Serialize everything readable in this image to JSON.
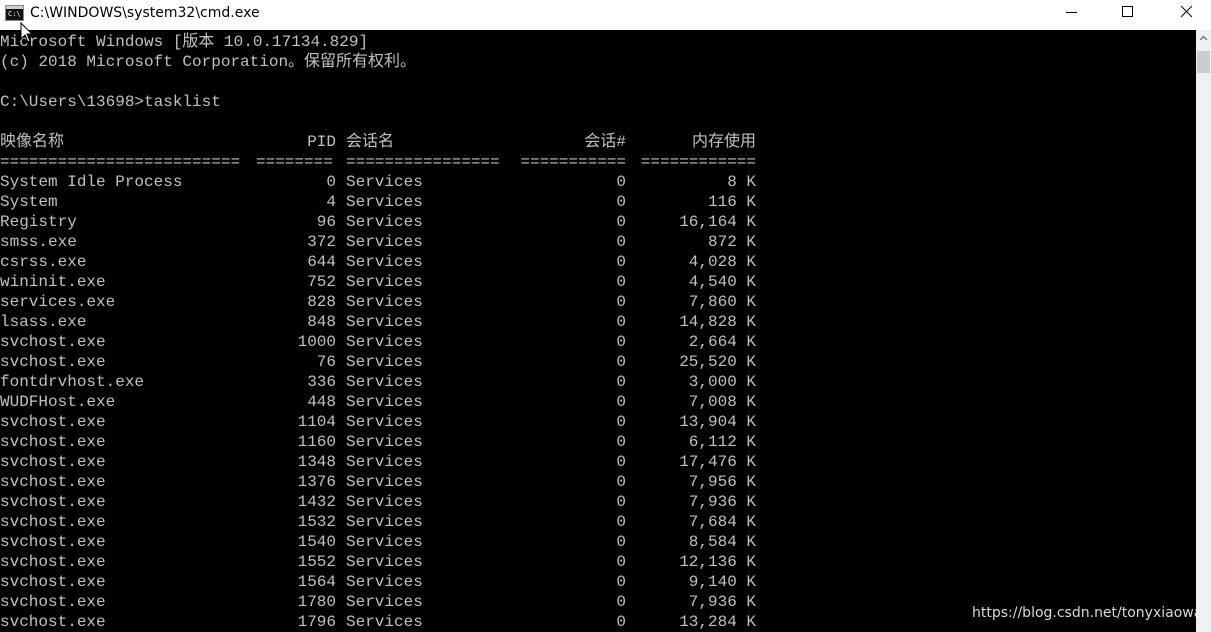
{
  "window": {
    "title": "C:\\WINDOWS\\system32\\cmd.exe",
    "icon_label": "C:\\",
    "icon": "console-icon"
  },
  "controls": {
    "minimize": "minimize-icon",
    "maximize": "maximize-icon",
    "close": "close-icon"
  },
  "console": {
    "banner_line1": "Microsoft Windows [版本 10.0.17134.829]",
    "banner_line2": "(c) 2018 Microsoft Corporation。保留所有权利。",
    "prompt_line": "C:\\Users\\13698>tasklist",
    "headers": {
      "name": "映像名称",
      "pid": "PID",
      "session_name": "会话名",
      "session_num": "会话#",
      "mem": "内存使用"
    },
    "separators": {
      "name": "=========================",
      "pid": "========",
      "session_name": "================",
      "session_num": "===========",
      "mem": "============"
    },
    "rows": [
      {
        "name": "System Idle Process",
        "pid": "0",
        "session_name": "Services",
        "session_num": "0",
        "mem": "8 K"
      },
      {
        "name": "System",
        "pid": "4",
        "session_name": "Services",
        "session_num": "0",
        "mem": "116 K"
      },
      {
        "name": "Registry",
        "pid": "96",
        "session_name": "Services",
        "session_num": "0",
        "mem": "16,164 K"
      },
      {
        "name": "smss.exe",
        "pid": "372",
        "session_name": "Services",
        "session_num": "0",
        "mem": "872 K"
      },
      {
        "name": "csrss.exe",
        "pid": "644",
        "session_name": "Services",
        "session_num": "0",
        "mem": "4,028 K"
      },
      {
        "name": "wininit.exe",
        "pid": "752",
        "session_name": "Services",
        "session_num": "0",
        "mem": "4,540 K"
      },
      {
        "name": "services.exe",
        "pid": "828",
        "session_name": "Services",
        "session_num": "0",
        "mem": "7,860 K"
      },
      {
        "name": "lsass.exe",
        "pid": "848",
        "session_name": "Services",
        "session_num": "0",
        "mem": "14,828 K"
      },
      {
        "name": "svchost.exe",
        "pid": "1000",
        "session_name": "Services",
        "session_num": "0",
        "mem": "2,664 K"
      },
      {
        "name": "svchost.exe",
        "pid": "76",
        "session_name": "Services",
        "session_num": "0",
        "mem": "25,520 K"
      },
      {
        "name": "fontdrvhost.exe",
        "pid": "336",
        "session_name": "Services",
        "session_num": "0",
        "mem": "3,000 K"
      },
      {
        "name": "WUDFHost.exe",
        "pid": "448",
        "session_name": "Services",
        "session_num": "0",
        "mem": "7,008 K"
      },
      {
        "name": "svchost.exe",
        "pid": "1104",
        "session_name": "Services",
        "session_num": "0",
        "mem": "13,904 K"
      },
      {
        "name": "svchost.exe",
        "pid": "1160",
        "session_name": "Services",
        "session_num": "0",
        "mem": "6,112 K"
      },
      {
        "name": "svchost.exe",
        "pid": "1348",
        "session_name": "Services",
        "session_num": "0",
        "mem": "17,476 K"
      },
      {
        "name": "svchost.exe",
        "pid": "1376",
        "session_name": "Services",
        "session_num": "0",
        "mem": "7,956 K"
      },
      {
        "name": "svchost.exe",
        "pid": "1432",
        "session_name": "Services",
        "session_num": "0",
        "mem": "7,936 K"
      },
      {
        "name": "svchost.exe",
        "pid": "1532",
        "session_name": "Services",
        "session_num": "0",
        "mem": "7,684 K"
      },
      {
        "name": "svchost.exe",
        "pid": "1540",
        "session_name": "Services",
        "session_num": "0",
        "mem": "8,584 K"
      },
      {
        "name": "svchost.exe",
        "pid": "1552",
        "session_name": "Services",
        "session_num": "0",
        "mem": "12,136 K"
      },
      {
        "name": "svchost.exe",
        "pid": "1564",
        "session_name": "Services",
        "session_num": "0",
        "mem": "9,140 K"
      },
      {
        "name": "svchost.exe",
        "pid": "1780",
        "session_name": "Services",
        "session_num": "0",
        "mem": "7,936 K"
      },
      {
        "name": "svchost.exe",
        "pid": "1796",
        "session_name": "Services",
        "session_num": "0",
        "mem": "13,284 K"
      }
    ]
  },
  "scrollbar": {
    "up_arrow": "scroll-up-arrow-icon"
  },
  "watermark": "https://blog.csdn.net/tonyxiaowa",
  "colors": {
    "console_bg": "#000000",
    "console_fg": "#c0c0c0",
    "titlebar_bg": "#ffffff"
  }
}
